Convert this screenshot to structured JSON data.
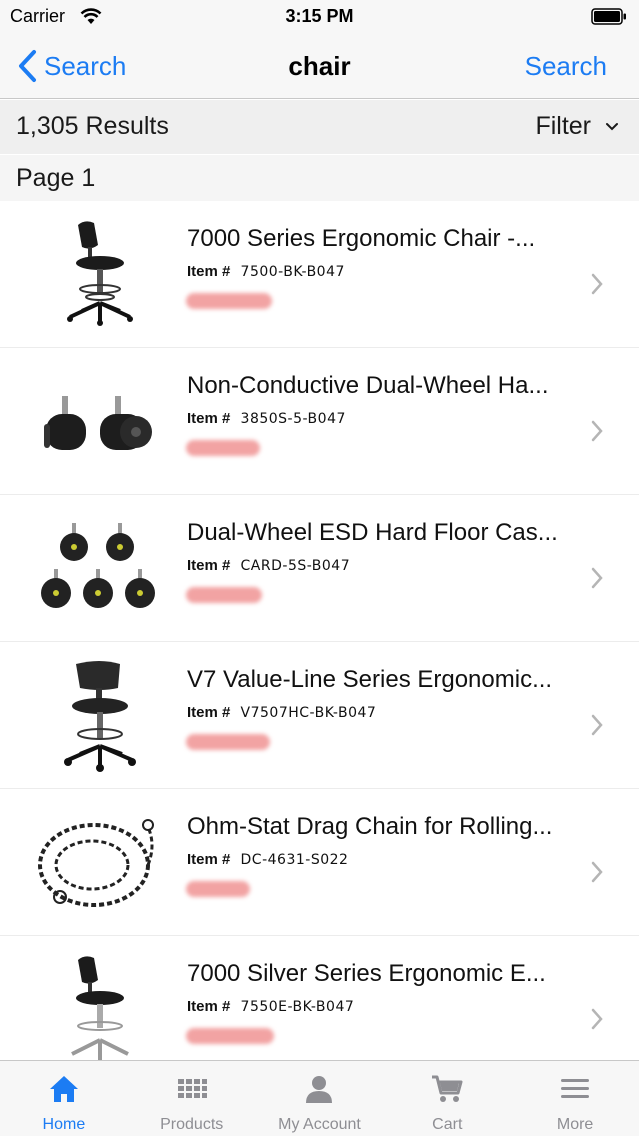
{
  "status_bar": {
    "carrier": "Carrier",
    "time": "3:15 PM"
  },
  "nav": {
    "back_label": "Search",
    "title": "chair",
    "search_label": "Search"
  },
  "results": {
    "count_label": "1,305 Results",
    "filter_label": "Filter"
  },
  "page_header": "Page 1",
  "products": [
    {
      "title": "7000 Series Ergonomic Chair -...",
      "item_label": "Item #",
      "item_number": "7500-BK-B047",
      "icon": "ergonomic-chair-image"
    },
    {
      "title": "Non-Conductive Dual-Wheel Ha...",
      "item_label": "Item #",
      "item_number": "3850S-5-B047",
      "icon": "dual-wheel-casters-image"
    },
    {
      "title": "Dual-Wheel ESD Hard Floor Cas...",
      "item_label": "Item #",
      "item_number": "CARD-5S-B047",
      "icon": "esd-casters-image"
    },
    {
      "title": "V7 Value-Line Series Ergonomic...",
      "item_label": "Item #",
      "item_number": "V7507HC-BK-B047",
      "icon": "value-line-chair-image"
    },
    {
      "title": "Ohm-Stat Drag Chain for Rolling...",
      "item_label": "Item #",
      "item_number": "DC-4631-S022",
      "icon": "drag-chain-image"
    },
    {
      "title": "7000 Silver Series Ergonomic E...",
      "item_label": "Item #",
      "item_number": "7550E-BK-B047",
      "icon": "silver-chair-image"
    }
  ],
  "tabs": [
    {
      "label": "Home",
      "icon": "home-icon",
      "active": true
    },
    {
      "label": "Products",
      "icon": "grid-icon",
      "active": false
    },
    {
      "label": "My Account",
      "icon": "person-icon",
      "active": false
    },
    {
      "label": "Cart",
      "icon": "cart-icon",
      "active": false
    },
    {
      "label": "More",
      "icon": "menu-icon",
      "active": false
    }
  ],
  "colors": {
    "accent": "#1c7cf3",
    "inactive_tab": "#8e8e93",
    "price_redacted": "#f2a3a3"
  }
}
